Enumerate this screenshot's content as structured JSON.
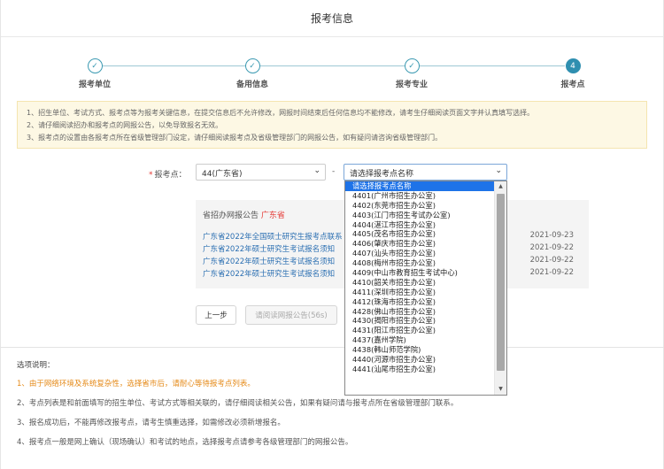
{
  "page": {
    "title": "报考信息"
  },
  "steps": [
    {
      "label": "报考单位",
      "state": "done",
      "icon": "check-icon"
    },
    {
      "label": "备用信息",
      "state": "done",
      "icon": "check-icon"
    },
    {
      "label": "报考专业",
      "state": "done",
      "icon": "check-icon"
    },
    {
      "label": "报考点",
      "state": "active",
      "number": "4"
    }
  ],
  "notice": {
    "lines": [
      "1、招生单位、考试方式、报考点等为报考关键信息，在提交信息后不允许修改，网报时间结束后任何信息均不能修改，请考生仔细阅读页面文字并认真填写选择。",
      "2、请仔细阅读招办和报考点的网报公告，以免导致报名无效。",
      "3、报考点的设置由各报考点所在省级管理部门设定，请仔细阅读报考点及省级管理部门的网报公告，如有疑问请咨询省级管理部门。"
    ]
  },
  "form": {
    "label": "报考点：",
    "required_mark": "*",
    "province_value": "44(广东省)",
    "separator": "-",
    "site_placeholder": "请选择报考点名称"
  },
  "dropdown": {
    "options": [
      "请选择报考点名称",
      "4401(广州市招生办公室)",
      "4402(东莞市招生办公室)",
      "4403(江门市招生考试办公室)",
      "4404(湛江市招生办公室)",
      "4405(茂名市招生办公室)",
      "4406(肇庆市招生办公室)",
      "4407(汕头市招生办公室)",
      "4408(梅州市招生办公室)",
      "4409(中山市教育招生考试中心)",
      "4410(韶关市招生办公室)",
      "4411(深圳市招生办公室)",
      "4412(珠海市招生办公室)",
      "4428(佛山市招生办公室)",
      "4430(揭阳市招生办公室)",
      "4431(阳江市招生办公室)",
      "4437(嘉州学院)",
      "4438(韩山师范学院)",
      "4440(河源市招生办公室)",
      "4441(汕尾市招生办公室)"
    ],
    "selected_index": 0
  },
  "announcements": {
    "heading": "省招办网报公告",
    "province": "广东省",
    "items": [
      {
        "title": "广东省2022年全国硕士研究生报考点联系",
        "date": "2021-09-23"
      },
      {
        "title": "广东省2022年硕士研究生考试报名须知",
        "date": "2021-09-22"
      },
      {
        "title": "广东省2022年硕士研究生考试报名须知",
        "date": "2021-09-22"
      },
      {
        "title": "广东省2022年硕士研究生考试报名须知",
        "date": "2021-09-22"
      }
    ]
  },
  "buttons": {
    "prev": "上一步",
    "read": "请阅读网报公告(56s)"
  },
  "notes": {
    "title": "选项说明：",
    "items": [
      {
        "text": "1、由于网络环境及系统复杂性，选择省市后，请耐心等待报考点列表。",
        "warn": true
      },
      {
        "text": "2、考点列表是和前面填写的招生单位、考试方式等相关联的，请仔细阅读相关公告，如果有疑问请与报考点所在省级管理部门联系。",
        "warn": false
      },
      {
        "text": "3、报名成功后，不能再修改报考点，请考生慎重选择，如需修改必须新增报名。",
        "warn": false
      },
      {
        "text": "4、报考点一般是网上确认（现场确认）和考试的地点，选择报考点请参考各级管理部门的网报公告。",
        "warn": false
      }
    ]
  },
  "colors": {
    "accent": "#2f8fb0",
    "link": "#2b6fb2",
    "warn": "#e58a18",
    "required": "#e53935",
    "selected": "#1e73e8"
  }
}
